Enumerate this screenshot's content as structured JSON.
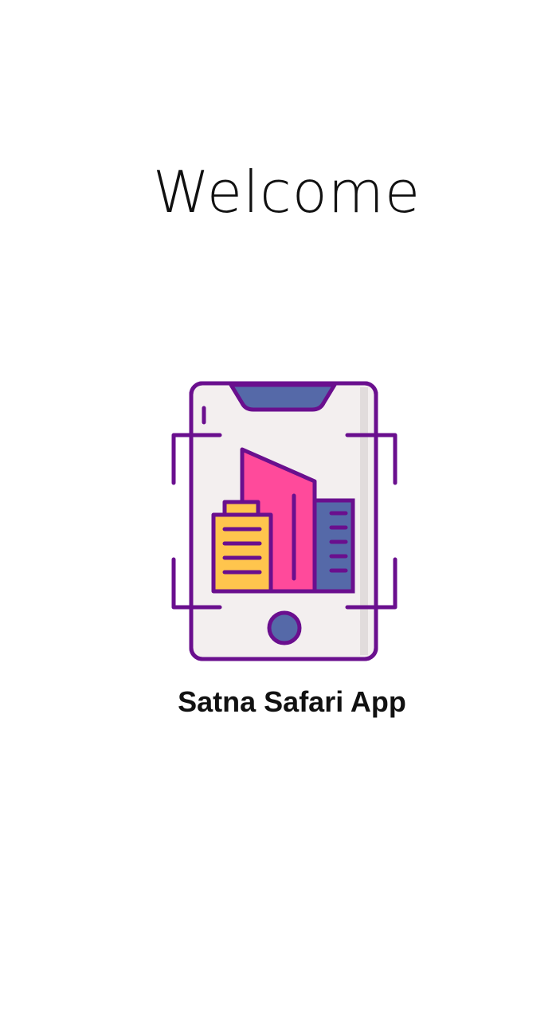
{
  "welcome": {
    "title": "Welcome"
  },
  "logo": {
    "icon": "smartphone-city-buildings-icon",
    "colors": {
      "outline": "#6a0f8e",
      "screen": "#f3efef",
      "notch": "#5569a8",
      "building_pink": "#ff4a9b",
      "building_yellow": "#ffc54d",
      "building_blue": "#5569a8",
      "home_button": "#5569a8"
    }
  },
  "app": {
    "name": "Satna Safari App"
  }
}
